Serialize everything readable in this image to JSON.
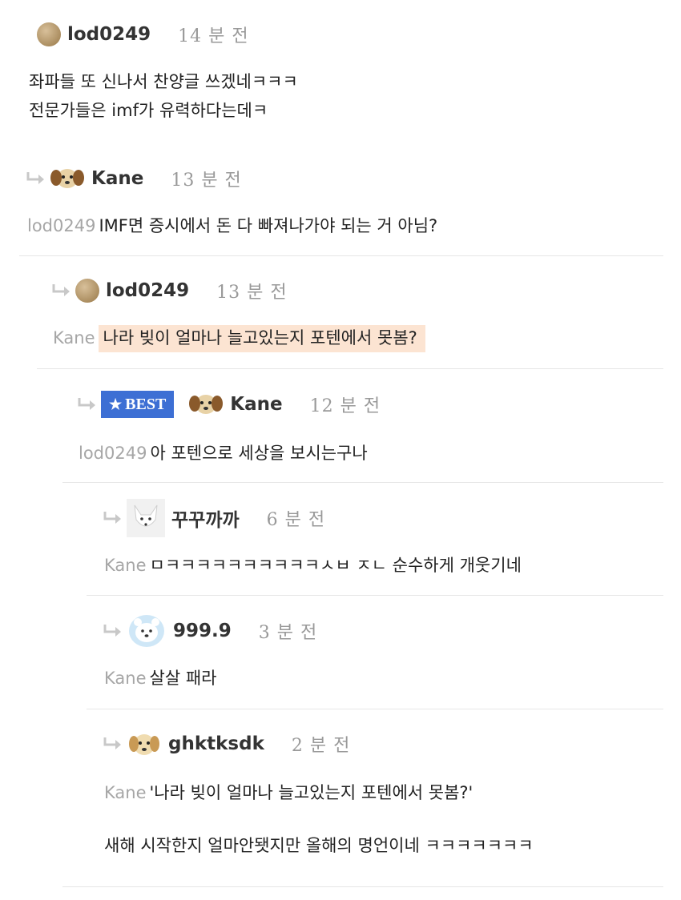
{
  "comments": [
    {
      "author": "lod0249",
      "time": "14 분 전",
      "avatar": "brown-circle-avatar",
      "lines": [
        "좌파들 또 신나서 찬양글 쓰겠네ㅋㅋㅋ",
        "전문가들은 imf가 유력하다는데ㅋ"
      ]
    },
    {
      "author": "Kane",
      "time": "13 분 전",
      "avatar": "puppy-avatar",
      "mention": "lod0249",
      "text": "IMF면 증시에서 돈 다 빠져나가야 되는 거 아님?"
    },
    {
      "author": "lod0249",
      "time": "13 분 전",
      "avatar": "brown-circle-avatar",
      "mention": "Kane",
      "text": "나라 빚이 얼마나 늘고있는지 포텐에서 못봄?",
      "highlighted": true
    },
    {
      "badge": "BEST",
      "author": "Kane",
      "time": "12 분 전",
      "avatar": "puppy-avatar",
      "mention": "lod0249",
      "text": "아 포텐으로 세상을 보시는구나"
    },
    {
      "author": "꾸꾸까까",
      "time": "6 분 전",
      "avatar": "white-fox-avatar",
      "mention": "Kane",
      "text": "ㅁㅋㅋㅋㅋㅋㅋㅋㅋㅋㅋㅅㅂ ㅈㄴ 순수하게 개웃기네"
    },
    {
      "author": "999.9",
      "time": "3 분 전",
      "avatar": "polar-bear-avatar",
      "mention": "Kane",
      "text": "살살 패라"
    },
    {
      "author": "ghktksdk",
      "time": "2 분 전",
      "avatar": "puppy-avatar",
      "mention": "Kane",
      "text": "'나라 빚이 얼마나 늘고있는지 포텐에서 못봄?'",
      "text2": "새해 시작한지 얼마안됏지만 올해의 명언이네 ㅋㅋㅋㅋㅋㅋㅋ"
    }
  ]
}
